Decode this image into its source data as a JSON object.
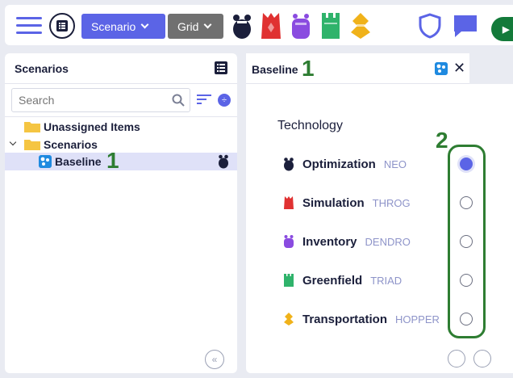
{
  "toolbar": {
    "scenario_label": "Scenario",
    "grid_label": "Grid",
    "tech_icons": [
      "neo-icon",
      "throg-icon",
      "dendro-icon",
      "triad-icon",
      "hopper-icon"
    ],
    "colors": {
      "accent": "#5b64e6",
      "neo": "#1b1f3b",
      "throg": "#e03131",
      "dendro": "#8a4be0",
      "triad": "#2fb36b",
      "hopper": "#f0b21a",
      "run": "#137a3a"
    }
  },
  "left_panel": {
    "title": "Scenarios",
    "search_placeholder": "Search",
    "tree": [
      {
        "label": "Unassigned Items",
        "type": "folder"
      },
      {
        "label": "Scenarios",
        "type": "folder",
        "expanded": true
      },
      {
        "label": "Baseline",
        "type": "scenario",
        "selected": true
      }
    ]
  },
  "right_panel": {
    "tab_title": "Baseline",
    "section_title": "Technology",
    "technologies": [
      {
        "name": "Optimization",
        "code": "NEO",
        "icon": "neo-icon",
        "selected": true
      },
      {
        "name": "Simulation",
        "code": "THROG",
        "icon": "throg-icon",
        "selected": false
      },
      {
        "name": "Inventory",
        "code": "DENDRO",
        "icon": "dendro-icon",
        "selected": false
      },
      {
        "name": "Greenfield",
        "code": "TRIAD",
        "icon": "triad-icon",
        "selected": false
      },
      {
        "name": "Transportation",
        "code": "HOPPER",
        "icon": "hopper-icon",
        "selected": false
      }
    ]
  },
  "annotations": {
    "marker_1": "1",
    "marker_2": "2"
  }
}
